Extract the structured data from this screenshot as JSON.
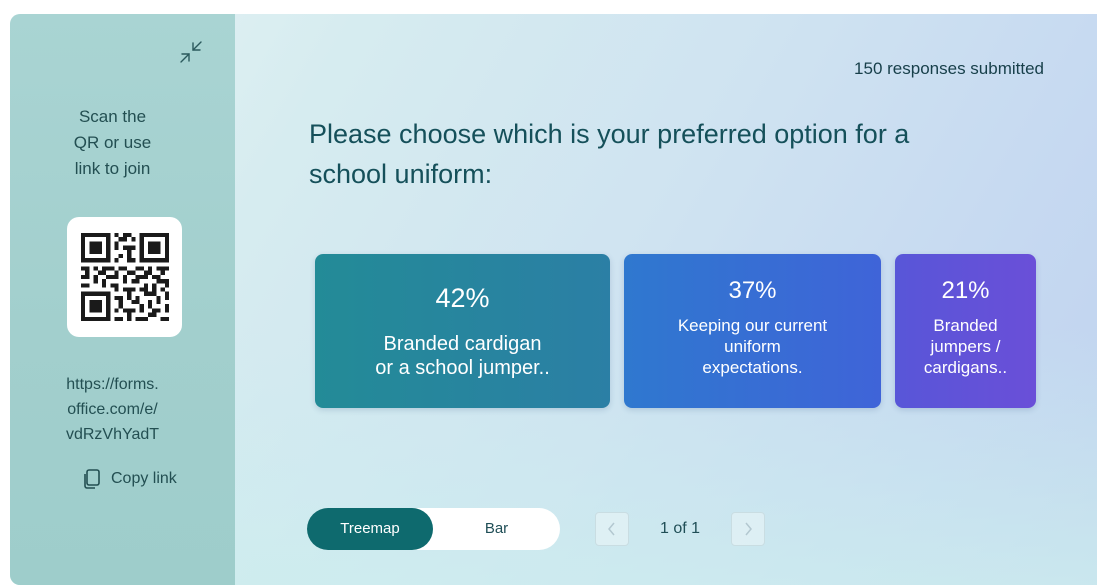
{
  "sidebar": {
    "scan_line1": "Scan the",
    "scan_line2": "QR or use",
    "scan_line3": "link to join",
    "link_line1": "https://forms.",
    "link_line2": "office.com/e/",
    "link_line3": "vdRzVhYadT",
    "copy_label": "Copy link"
  },
  "header": {
    "responses": "150 responses submitted"
  },
  "question": {
    "line1": "Please choose which is your preferred option for a",
    "line2": "school uniform:"
  },
  "results": [
    {
      "percent": "42%",
      "label_line1": "Branded cardigan",
      "label_line2": "or a school jumper..",
      "color": "#238b97"
    },
    {
      "percent": "37%",
      "label_line1": "Keeping our current",
      "label_line2": "uniform",
      "label_line3": "expectations.",
      "color": "#3a6cd5"
    },
    {
      "percent": "21%",
      "label_line1": "Branded",
      "label_line2": "jumpers /",
      "label_line3": "cardigans..",
      "color": "#5f53d8"
    }
  ],
  "view_toggle": {
    "treemap_label": "Treemap",
    "bar_label": "Bar",
    "selected": "Treemap"
  },
  "pager": {
    "text": "1 of 1"
  },
  "icons": [
    "collapse-icon",
    "qr-code-icon",
    "copy-icon",
    "chevron-left-icon",
    "chevron-right-icon"
  ],
  "colors": {
    "accent": "#0e6a6e",
    "sidebar": "#a6d2d1",
    "text": "#15505a"
  }
}
